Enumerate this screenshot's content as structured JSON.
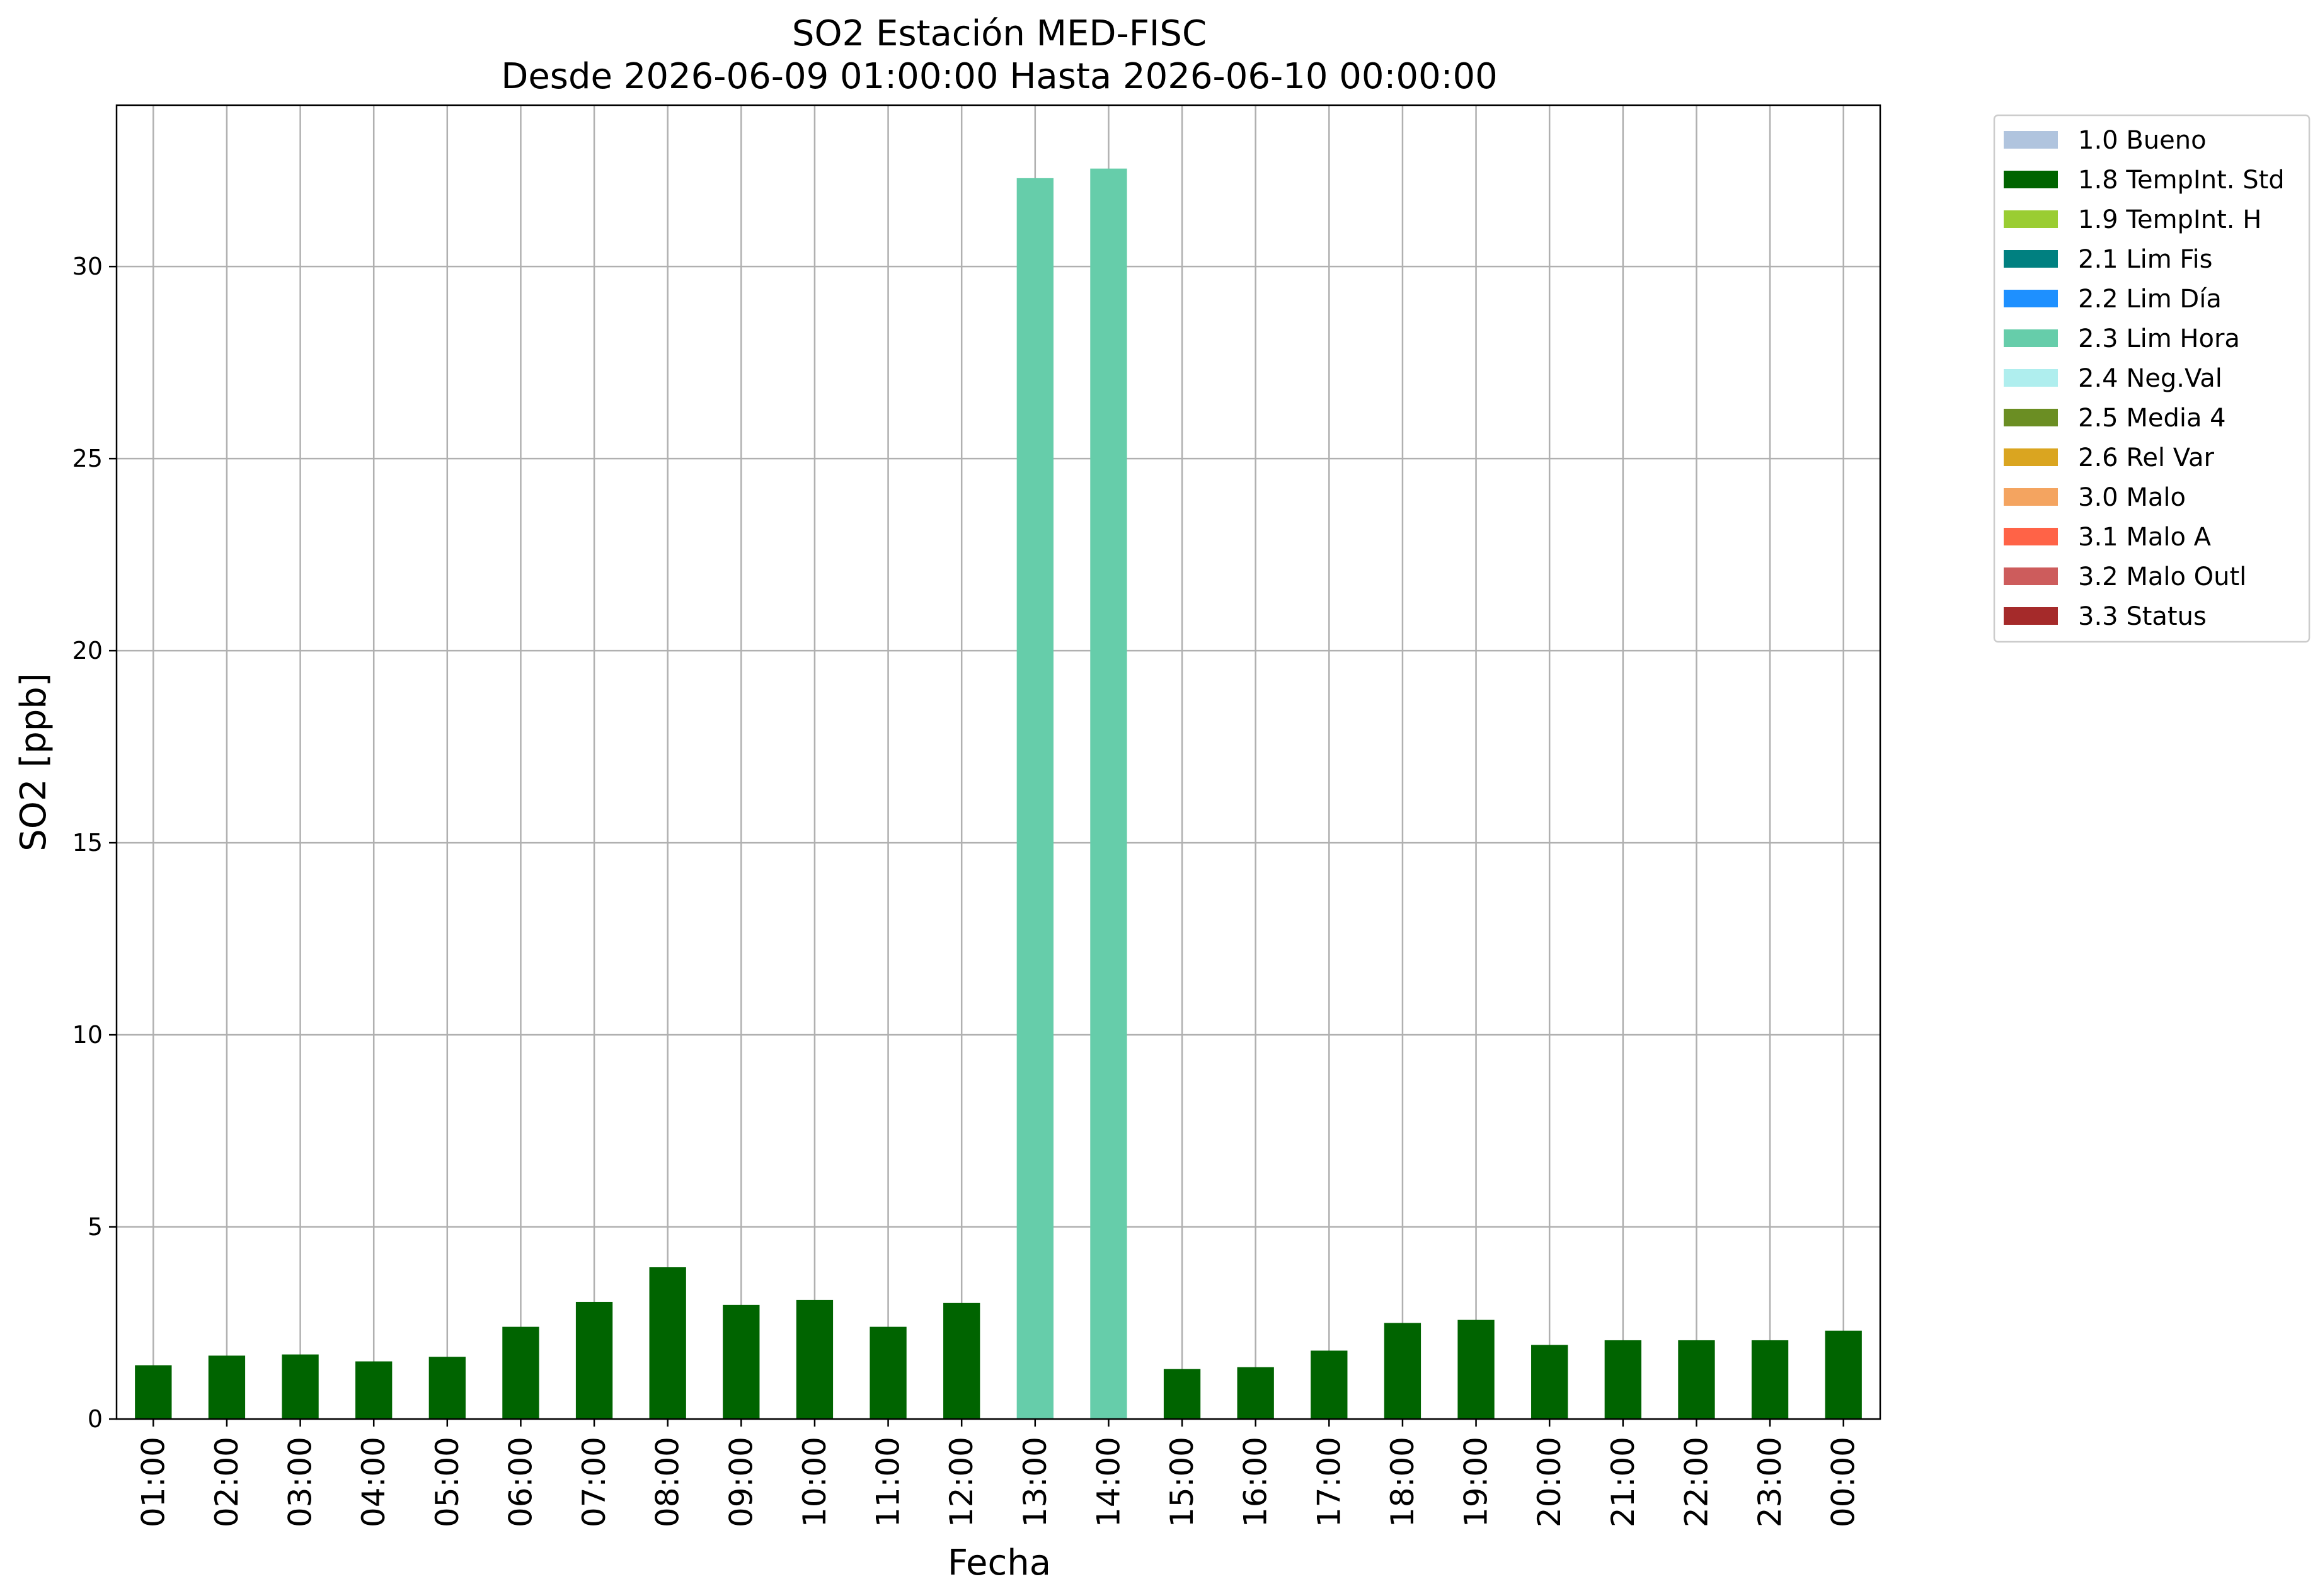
{
  "chart_data": {
    "type": "bar",
    "title": "SO2 Estación MED-FISC",
    "subtitle": "Desde 2026-06-09 01:00:00 Hasta 2026-06-10 00:00:00",
    "xlabel": "Fecha",
    "ylabel": "SO2 [ppb]",
    "ylim": [
      0,
      34.2
    ],
    "yticks": [
      0,
      5,
      10,
      15,
      20,
      25,
      30
    ],
    "grid": true,
    "legend_position": "outside-top-right",
    "categories": [
      "01:00",
      "02:00",
      "03:00",
      "04:00",
      "05:00",
      "06:00",
      "07:00",
      "08:00",
      "09:00",
      "10:00",
      "11:00",
      "12:00",
      "13:00",
      "14:00",
      "15:00",
      "16:00",
      "17:00",
      "18:00",
      "19:00",
      "20:00",
      "21:00",
      "22:00",
      "23:00",
      "00:00"
    ],
    "values": [
      1.4,
      1.65,
      1.68,
      1.5,
      1.62,
      2.4,
      3.05,
      3.95,
      2.97,
      3.1,
      2.4,
      3.02,
      32.3,
      32.55,
      1.3,
      1.35,
      1.78,
      2.5,
      2.58,
      1.93,
      2.05,
      2.05,
      2.05,
      2.3
    ],
    "flags": [
      "1.8 TempInt. Std",
      "1.8 TempInt. Std",
      "1.8 TempInt. Std",
      "1.8 TempInt. Std",
      "1.8 TempInt. Std",
      "1.8 TempInt. Std",
      "1.8 TempInt. Std",
      "1.8 TempInt. Std",
      "1.8 TempInt. Std",
      "1.8 TempInt. Std",
      "1.8 TempInt. Std",
      "1.8 TempInt. Std",
      "2.3 Lim Hora",
      "2.3 Lim Hora",
      "1.8 TempInt. Std",
      "1.8 TempInt. Std",
      "1.8 TempInt. Std",
      "1.8 TempInt. Std",
      "1.8 TempInt. Std",
      "1.8 TempInt. Std",
      "1.8 TempInt. Std",
      "1.8 TempInt. Std",
      "1.8 TempInt. Std",
      "1.8 TempInt. Std"
    ],
    "legend": [
      {
        "label": "1.0 Bueno",
        "color": "#b0c4de"
      },
      {
        "label": "1.8 TempInt. Std",
        "color": "#006400"
      },
      {
        "label": "1.9 TempInt. H",
        "color": "#9acd32"
      },
      {
        "label": "2.1 Lim Fis",
        "color": "#008080"
      },
      {
        "label": "2.2 Lim Día",
        "color": "#1e90ff"
      },
      {
        "label": "2.3 Lim Hora",
        "color": "#66cdaa"
      },
      {
        "label": "2.4 Neg.Val",
        "color": "#afeeee"
      },
      {
        "label": "2.5 Media 4",
        "color": "#6b8e23"
      },
      {
        "label": "2.6 Rel Var",
        "color": "#daa520"
      },
      {
        "label": "3.0 Malo",
        "color": "#f4a460"
      },
      {
        "label": "3.1 Malo A",
        "color": "#ff6347"
      },
      {
        "label": "3.2 Malo Outl",
        "color": "#cd5c5c"
      },
      {
        "label": "3.3 Status",
        "color": "#a52a2a"
      }
    ],
    "grid_color": "#b0b0b0"
  }
}
